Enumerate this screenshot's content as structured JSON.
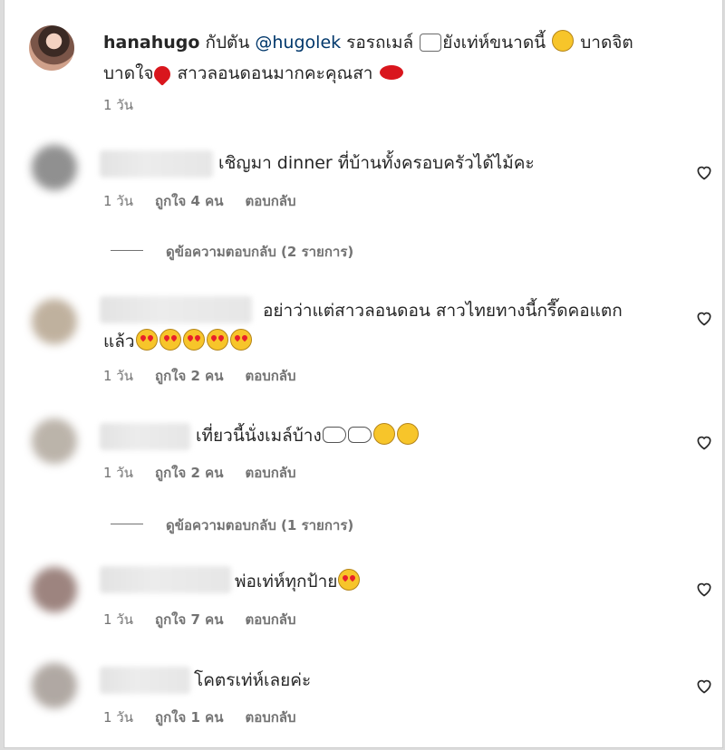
{
  "post": {
    "username": "hanahugo",
    "caption_part1": " กัปตัน ",
    "mention": "@hugolek",
    "caption_part2": " รอรถเมล์ ",
    "caption_part3": "ยังเท่ห์ขนาดนี้ ",
    "caption_part4": " บาดจิต",
    "caption_part5": "บาดใจ",
    "caption_part6": " สาวลอนดอนมากคะคุณสา ",
    "time": "1 วัน"
  },
  "comments": [
    {
      "text": "เชิญมา dinner ที่บ้านทั้งครอบครัวได้ไม้คะ",
      "time": "1 วัน",
      "likes": "ถูกใจ 4 คน",
      "reply": "ตอบกลับ",
      "view_replies": "ดูข้อความตอบกลับ (2 รายการ)"
    },
    {
      "text": "อย่าว่าแต่สาวลอนดอน สาวไทยทางนี้กรี๊ดคอแตก",
      "text2": "แล้ว",
      "time": "1 วัน",
      "likes": "ถูกใจ 2 คน",
      "reply": "ตอบกลับ"
    },
    {
      "text": "เที่ยวนี้นั่งเมล์บ้าง",
      "time": "1 วัน",
      "likes": "ถูกใจ 2 คน",
      "reply": "ตอบกลับ",
      "view_replies": "ดูข้อความตอบกลับ (1 รายการ)"
    },
    {
      "text": "พ่อเท่ห์ทุกป้าย",
      "time": "1 วัน",
      "likes": "ถูกใจ 7 คน",
      "reply": "ตอบกลับ"
    },
    {
      "text": "โคตรเท่ห์เลยค่ะ",
      "time": "1 วัน",
      "likes": "ถูกใจ 1 คน",
      "reply": "ตอบกลับ"
    }
  ],
  "icons": {
    "like": "heart-outline-icon"
  }
}
